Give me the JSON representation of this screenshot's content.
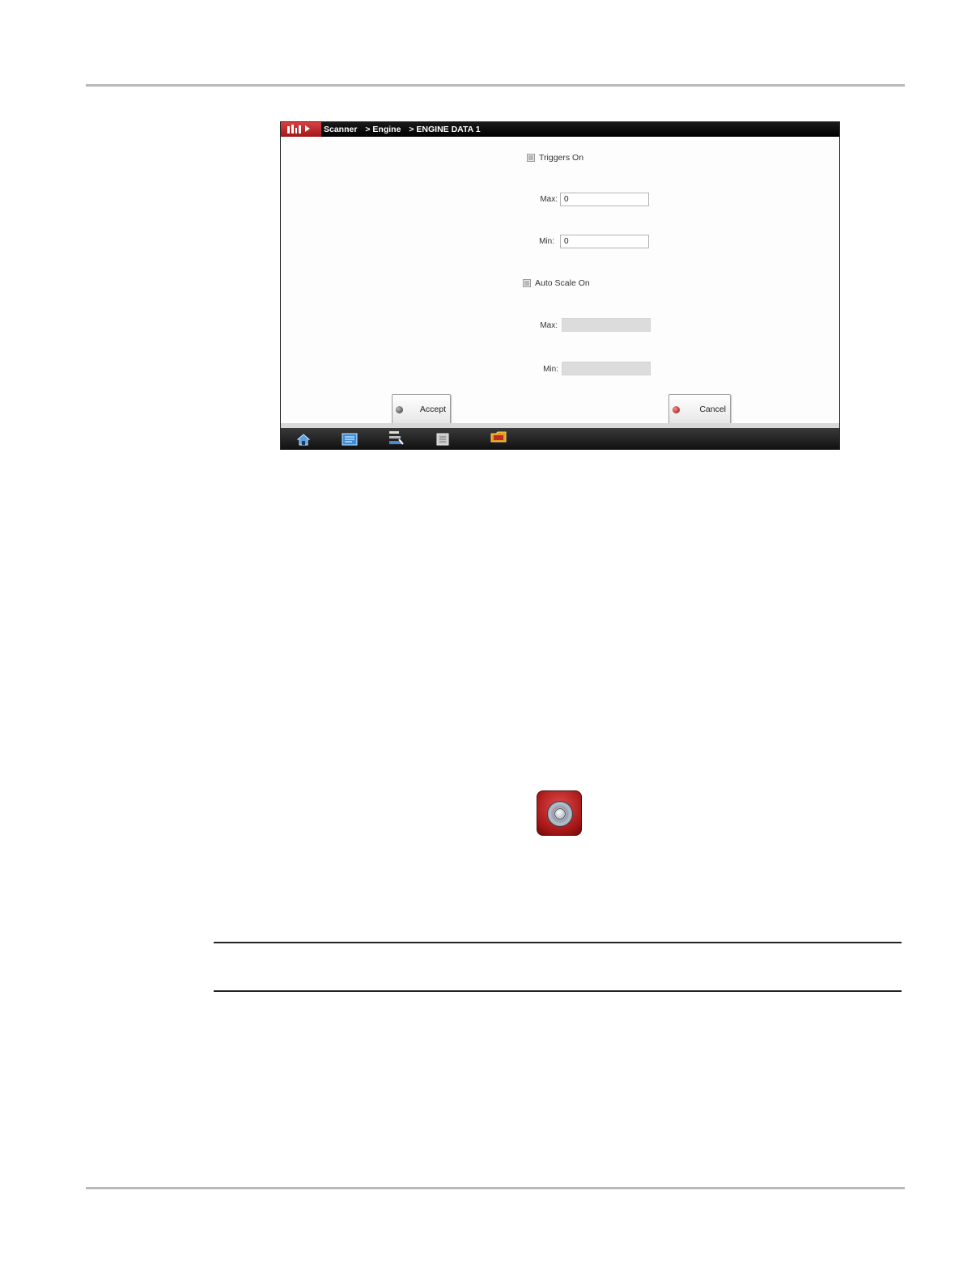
{
  "screen": {
    "breadcrumb": [
      "Scanner",
      "> Engine",
      "> ENGINE DATA 1"
    ],
    "triggers": {
      "checkbox_label": "Triggers On",
      "checked": true,
      "max_label": "Max:",
      "max_value": "0",
      "min_label": "Min:",
      "min_value": "0"
    },
    "auto_scale": {
      "checkbox_label": "Auto Scale On",
      "checked": true,
      "max_label": "Max:",
      "min_label": "Min:"
    },
    "accept_label": "Accept",
    "cancel_label": "Cancel",
    "taskbar_icons": [
      "home-icon",
      "data-list-icon",
      "tools-icon",
      "notes-icon",
      "folder-icon"
    ]
  },
  "colors": {
    "brand_red": "#c62828",
    "titlebar": "#000000"
  }
}
